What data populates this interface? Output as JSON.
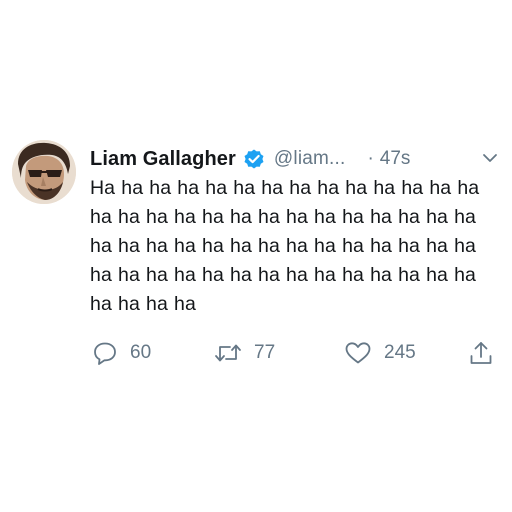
{
  "tweet": {
    "author_name": "Liam Gallagher",
    "handle": "@liam...",
    "separator": "·",
    "time": "47s",
    "text": "Ha ha ha ha ha ha ha ha ha ha ha ha ha ha ha ha ha ha ha ha ha ha ha ha ha ha ha ha ha ha ha ha ha ha ha ha ha ha ha ha ha ha ha ha ha ha ha ha ha ha ha ha ha ha ha ha ha ha ha ha",
    "verified": true,
    "avatar_icon": "profile-photo",
    "actions": {
      "reply_count": "60",
      "retweet_count": "77",
      "like_count": "245"
    },
    "icons": {
      "verified": "verified-badge-icon",
      "caret": "chevron-down-icon",
      "reply": "reply-icon",
      "retweet": "retweet-icon",
      "like": "heart-icon",
      "share": "share-icon"
    }
  },
  "colors": {
    "text": "#14171a",
    "secondary": "#657786",
    "verified_blue": "#1da1f2",
    "background": "#ffffff"
  }
}
